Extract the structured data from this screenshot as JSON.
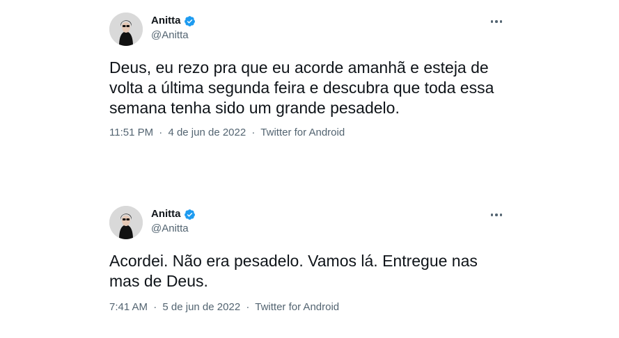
{
  "tweets": [
    {
      "display_name": "Anitta",
      "handle": "@Anitta",
      "text": "Deus, eu rezo pra que eu acorde amanhã e esteja de\nvolta a última segunda feira e descubra que toda essa\nsemana tenha sido um grande pesadelo.",
      "time": "11:51 PM",
      "date": "4 de jun de 2022",
      "separator": "·",
      "source": "Twitter for Android",
      "icons": [
        "avatar-photo",
        "verified-badge-icon",
        "more-options-icon"
      ]
    },
    {
      "display_name": "Anitta",
      "handle": "@Anitta",
      "text": "Acordei. Não era pesadelo. Vamos lá. Entregue nas\nmas de Deus.",
      "time": "7:41 AM",
      "date": "5 de jun de 2022",
      "separator": "·",
      "source": "Twitter for Android",
      "icons": [
        "avatar-photo",
        "verified-badge-icon",
        "more-options-icon"
      ]
    }
  ],
  "colors": {
    "text": "#0f1419",
    "secondary": "#536471",
    "verified": "#1d9bf0"
  }
}
